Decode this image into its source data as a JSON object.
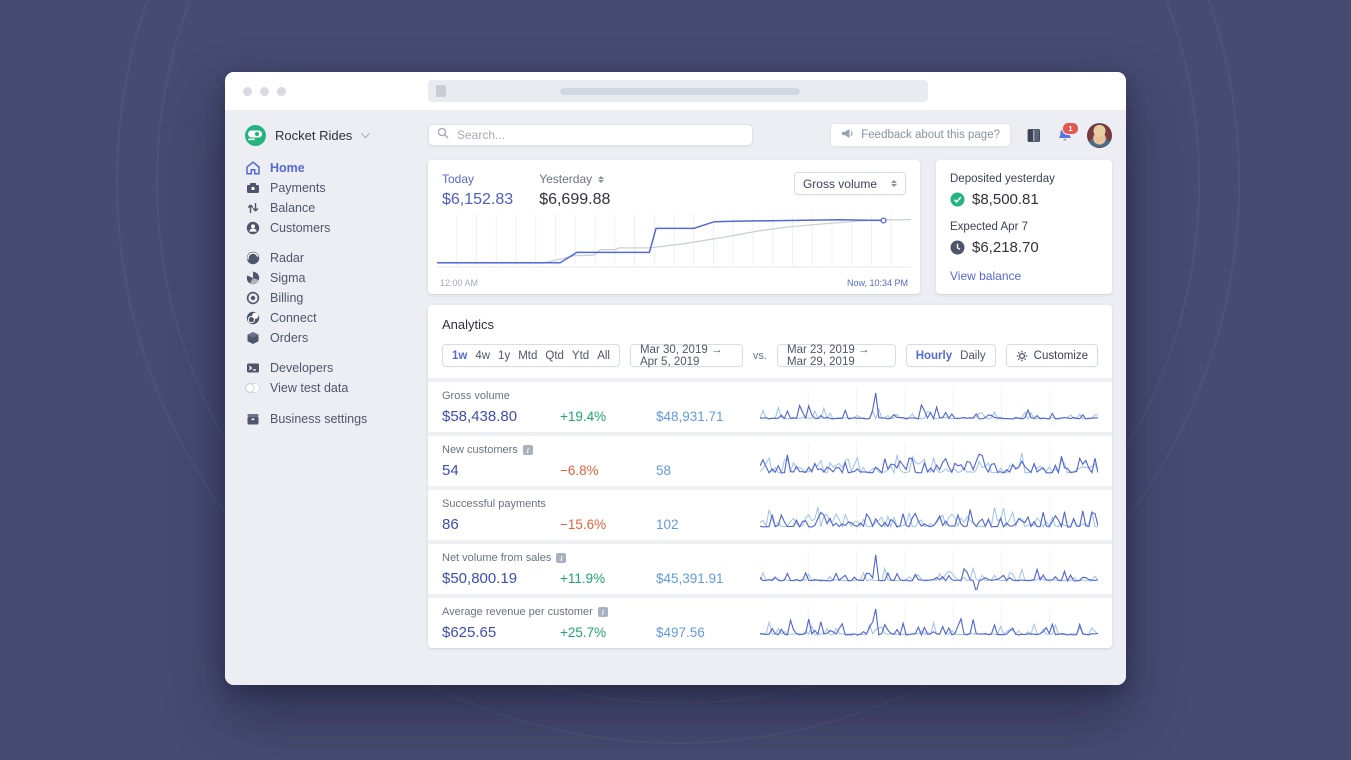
{
  "colors": {
    "accent_blue": "#5469d4",
    "value_indigo": "#3e4db2",
    "positive_green": "#1ea672",
    "negative_orange": "#e8603c",
    "compare_blue": "#639ae5",
    "brand_green": "#24b47e",
    "badge_red": "#e25950"
  },
  "sidebar": {
    "account_name": "Rocket Rides",
    "items": [
      {
        "label": "Home",
        "active": true
      },
      {
        "label": "Payments"
      },
      {
        "label": "Balance"
      },
      {
        "label": "Customers"
      },
      {
        "label": "Radar"
      },
      {
        "label": "Sigma"
      },
      {
        "label": "Billing"
      },
      {
        "label": "Connect"
      },
      {
        "label": "Orders"
      },
      {
        "label": "Developers"
      },
      {
        "label": "View test data"
      },
      {
        "label": "Business settings"
      }
    ]
  },
  "topbar": {
    "search_placeholder": "Search...",
    "feedback_label": "Feedback about this page?",
    "notification_count": "1"
  },
  "today_card": {
    "today_label": "Today",
    "today_value": "$6,152.83",
    "yesterday_label": "Yesterday",
    "yesterday_value": "$6,699.88",
    "metric_select": "Gross volume",
    "x_start": "12:00 AM",
    "x_end": "Now, 10:34 PM",
    "chart": {
      "type": "line",
      "grid_divisions": 24,
      "today_points": [
        [
          0,
          0.995
        ],
        [
          0.26,
          0.995
        ],
        [
          0.295,
          0.78
        ],
        [
          0.448,
          0.78
        ],
        [
          0.462,
          0.28
        ],
        [
          0.542,
          0.28
        ],
        [
          0.585,
          0.14
        ],
        [
          0.625,
          0.13
        ],
        [
          0.85,
          0.1
        ],
        [
          0.942,
          0.115
        ]
      ],
      "yesterday_points": [
        [
          0,
          1.0
        ],
        [
          0.225,
          1.0
        ],
        [
          0.29,
          0.845
        ],
        [
          0.33,
          0.84
        ],
        [
          0.345,
          0.72
        ],
        [
          0.375,
          0.72
        ],
        [
          0.385,
          0.685
        ],
        [
          0.448,
          0.685
        ],
        [
          0.52,
          0.6
        ],
        [
          0.6,
          0.47
        ],
        [
          0.68,
          0.33
        ],
        [
          0.74,
          0.25
        ],
        [
          0.82,
          0.18
        ],
        [
          0.92,
          0.105
        ],
        [
          1.0,
          0.095
        ]
      ]
    }
  },
  "deposit_card": {
    "deposited_label": "Deposited yesterday",
    "deposited_value": "$8,500.81",
    "expected_label": "Expected Apr 7",
    "expected_value": "$6,218.70",
    "link_label": "View balance"
  },
  "analytics": {
    "title": "Analytics",
    "range_tabs": [
      "1w",
      "4w",
      "1y",
      "Mtd",
      "Qtd",
      "Ytd",
      "All"
    ],
    "active_tab": "1w",
    "date_range": "Mar 30, 2019 →  Apr 5, 2019",
    "vs_label": "vs.",
    "compare_range": "Mar 23, 2019 → Mar 29, 2019",
    "granularity": [
      "Hourly",
      "Daily"
    ],
    "active_granularity": "Hourly",
    "customize_label": "Customize",
    "rows": [
      {
        "label": "Gross volume",
        "info": false,
        "value": "$58,438.80",
        "delta": "+19.4%",
        "delta_dir": "up",
        "compare": "$48,931.71",
        "sparkline": {
          "seed": 11,
          "density": 0.2,
          "amp": 0.55,
          "big_spike": 0.34
        }
      },
      {
        "label": "New customers",
        "info": true,
        "value": "54",
        "delta": "−6.8%",
        "delta_dir": "down",
        "compare": "58",
        "sparkline": {
          "seed": 23,
          "density": 0.55,
          "amp": 0.8
        }
      },
      {
        "label": "Successful payments",
        "info": false,
        "value": "86",
        "delta": "−15.6%",
        "delta_dir": "down",
        "compare": "102",
        "sparkline": {
          "seed": 37,
          "density": 0.5,
          "amp": 0.75
        }
      },
      {
        "label": "Net volume from sales",
        "info": true,
        "value": "$50,800.19",
        "delta": "+11.9%",
        "delta_dir": "up",
        "compare": "$45,391.91",
        "sparkline": {
          "seed": 51,
          "density": 0.2,
          "amp": 0.5,
          "big_spike": 0.34,
          "dip": 0.63
        }
      },
      {
        "label": "Average revenue per customer",
        "info": true,
        "value": "$625.65",
        "delta": "+25.7%",
        "delta_dir": "up",
        "compare": "$497.56",
        "sparkline": {
          "seed": 67,
          "density": 0.22,
          "amp": 0.6,
          "big_spike": 0.34
        }
      }
    ]
  }
}
